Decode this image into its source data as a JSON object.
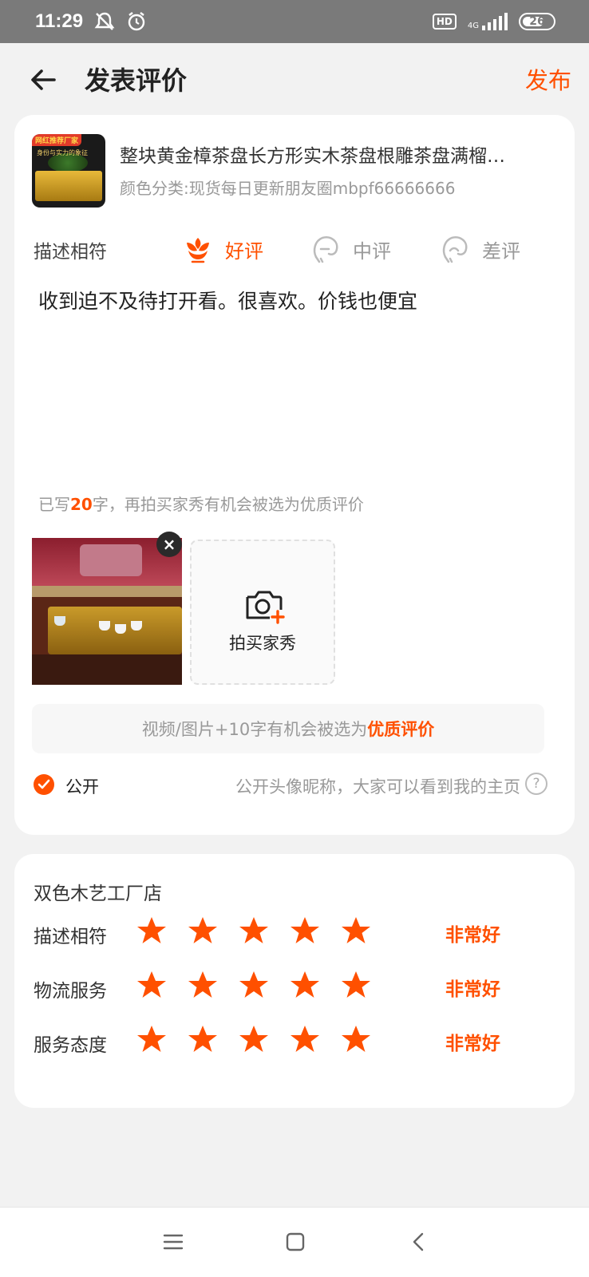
{
  "status_bar": {
    "time": "11:29",
    "hd": "HD",
    "network": "4G",
    "battery": "26"
  },
  "header": {
    "title": "发表评价",
    "publish": "发布"
  },
  "product": {
    "title": "整块黄金樟茶盘长方形实木茶盘根雕茶盘满榴…",
    "spec": "颜色分类:现货每日更新朋友圈mbpf66666666",
    "thumb_tag": "网红推荐厂家",
    "thumb_sub": "身份与实力的象征"
  },
  "rating": {
    "label": "描述相符",
    "good": "好评",
    "mid": "中评",
    "bad": "差评"
  },
  "review": {
    "text": "收到迫不及待打开看。很喜欢。价钱也便宜",
    "count_prefix": "已写",
    "count": "20",
    "count_suffix": "字，再拍买家秀有机会被选为优质评价"
  },
  "photos": {
    "add_label": "拍买家秀",
    "close": "×"
  },
  "hint": {
    "text": "视频/图片+10字有机会被选为",
    "highlight": "优质评价"
  },
  "public": {
    "label": "公开",
    "desc": "公开头像昵称，大家可以看到我的主页",
    "help": "?"
  },
  "shop": {
    "name": "双色木艺工厂店",
    "scores": [
      {
        "label": "描述相符",
        "stars": 5,
        "text": "非常好"
      },
      {
        "label": "物流服务",
        "stars": 5,
        "text": "非常好"
      },
      {
        "label": "服务态度",
        "stars": 5,
        "text": "非常好"
      }
    ]
  },
  "colors": {
    "accent": "#ff5000",
    "background": "#f2f2f2",
    "status_bar": "#7a7a7a"
  },
  "icons": [
    "back-arrow-icon",
    "flower-good-icon",
    "face-mid-icon",
    "face-bad-icon",
    "camera-plus-icon",
    "close-icon",
    "check-icon",
    "help-icon",
    "star-icon",
    "menu-icon",
    "home-icon",
    "back-nav-icon"
  ]
}
